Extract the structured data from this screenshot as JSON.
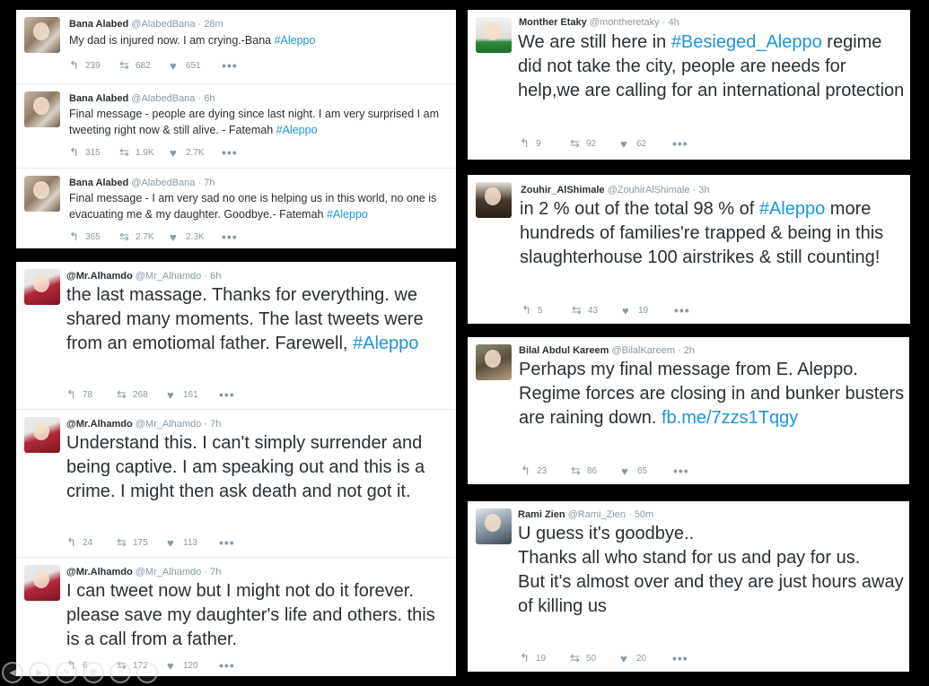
{
  "panel_a": [
    {
      "name": "Bana Alabed",
      "handle": "@AlabedBana",
      "time": "28m",
      "pre": "My dad is injured now. I am crying.-Bana ",
      "tag": "#Aleppo",
      "post": "",
      "reply": "239",
      "retweet": "682",
      "like": "651"
    },
    {
      "name": "Bana Alabed",
      "handle": "@AlabedBana",
      "time": "6h",
      "pre": "Final message - people are dying since last night. I am very surprised I am tweeting right now & still alive. - Fatemah ",
      "tag": "#Aleppo",
      "post": "",
      "reply": "315",
      "retweet": "1.9K",
      "like": "2.7K"
    },
    {
      "name": "Bana Alabed",
      "handle": "@AlabedBana",
      "time": "7h",
      "pre": "Final message - I am very sad no one is helping us in this world, no one is evacuating me & my daughter. Goodbye.- Fatemah ",
      "tag": "#Aleppo",
      "post": "",
      "reply": "365",
      "retweet": "2.7K",
      "like": "2.3K"
    }
  ],
  "panel_b": [
    {
      "name": "@Mr.Alhamdo",
      "handle": "@Mr_Alhamdo",
      "time": "6h",
      "pre": "the last massage. Thanks for everything. we shared many moments. The last tweets were from an emotiomal father. Farewell, ",
      "tag": "#Aleppo",
      "post": "",
      "reply": "78",
      "retweet": "268",
      "like": "161"
    },
    {
      "name": "@Mr.Alhamdo",
      "handle": "@Mr_Alhamdo",
      "time": "7h",
      "pre": "Understand this. I can't simply surrender and being captive. I am speaking out and this is a crime. I might then ask death and not got it.",
      "tag": "",
      "post": "",
      "reply": "24",
      "retweet": "175",
      "like": "113"
    },
    {
      "name": "@Mr.Alhamdo",
      "handle": "@Mr_Alhamdo",
      "time": "7h",
      "pre": "I can tweet now but I might not do it forever. please save my daughter's life and others. this is a call from a father.",
      "tag": "",
      "post": "",
      "reply": "6",
      "retweet": "172",
      "like": "120"
    }
  ],
  "panel_c": {
    "name": "Monther Etaky",
    "handle": "@montheretaky",
    "time": "4h",
    "pre": "We are still here in ",
    "tag": "#Besieged_Aleppo",
    "post": " regime did not take the city, people are needs for help,we are calling for an international protection",
    "reply": "9",
    "retweet": "92",
    "like": "62"
  },
  "panel_d": {
    "name": "Zouhir_AlShimale",
    "handle": "@ZouhirAlShimale",
    "time": "3h",
    "pre": "in 2 % out of the total 98 % of ",
    "tag": "#Aleppo",
    "post": " more hundreds of families're trapped & being in this slaughterhouse 100 airstrikes & still counting!",
    "reply": "5",
    "retweet": "43",
    "like": "19"
  },
  "panel_e": {
    "name": "Bilal Abdul Kareem",
    "handle": "@BilalKareem",
    "time": "2h",
    "pre": "Perhaps my final message from E. Aleppo. Regime forces are closing in and bunker busters are raining down. ",
    "tag": "",
    "link": "fb.me/7zzs1Tqgy",
    "post": "",
    "reply": "23",
    "retweet": "86",
    "like": "65"
  },
  "panel_f": {
    "name": "Rami Zien",
    "handle": "@Rami_Zien",
    "time": "50m",
    "line1": "U guess it's goodbye..",
    "line2": "Thanks all who stand for us and pay for us.",
    "line3": "But it's almost over and they are just hours away of killing us",
    "reply": "19",
    "retweet": "50",
    "like": "20"
  },
  "icons": {
    "reply": "reply-icon",
    "retweet": "retweet-icon",
    "like": "heart-icon",
    "more": "more-icon"
  },
  "colors": {
    "link": "#1b95e0",
    "text": "#292f33",
    "meta": "#8899a6",
    "background": "#000000"
  }
}
